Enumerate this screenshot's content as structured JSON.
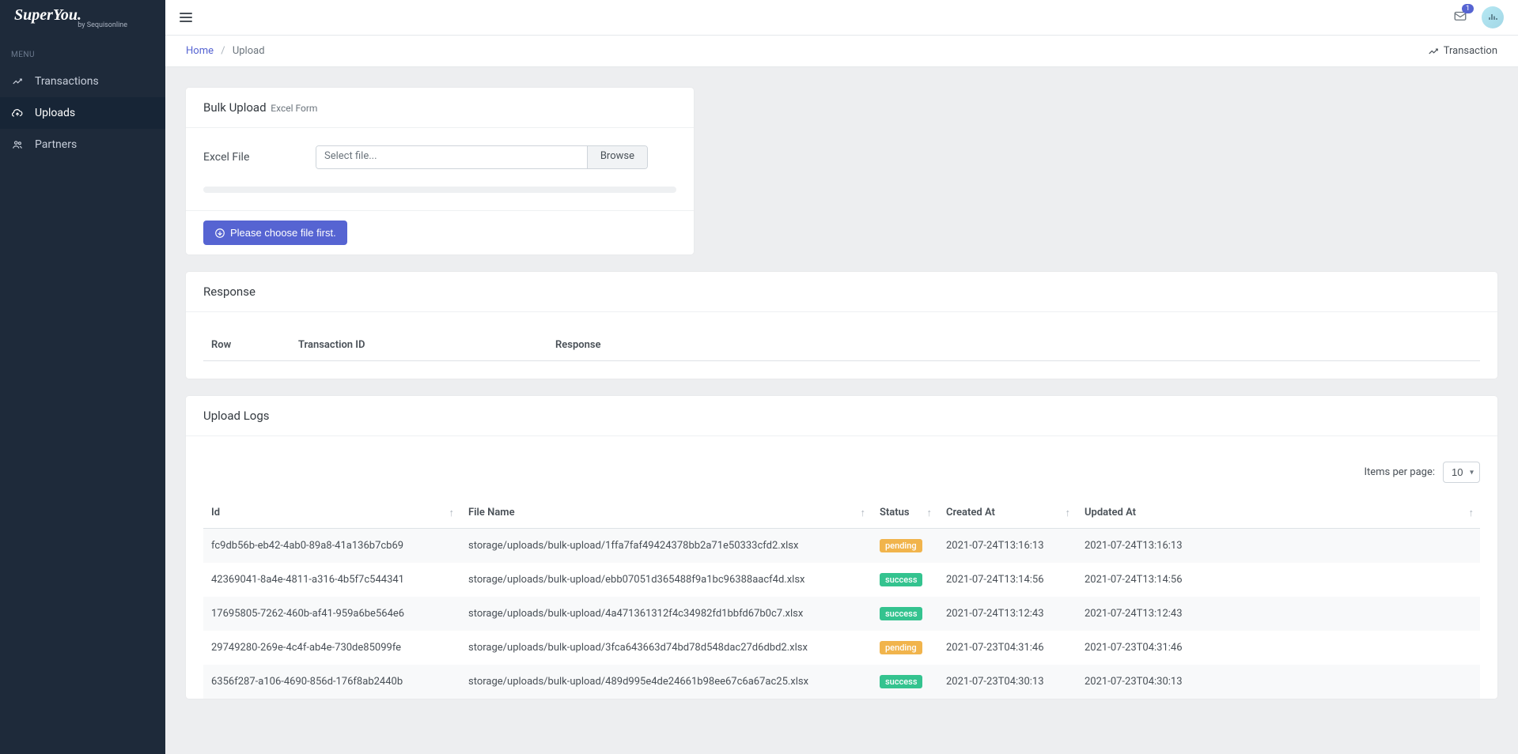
{
  "brand": {
    "main": "SuperYou.",
    "sub": "by Sequisonline"
  },
  "sidebar": {
    "menu_label": "MENU",
    "items": [
      {
        "label": "Transactions",
        "icon": "chart"
      },
      {
        "label": "Uploads",
        "icon": "cloud"
      },
      {
        "label": "Partners",
        "icon": "users"
      }
    ]
  },
  "topbar": {
    "notif_count": "1"
  },
  "breadcrumb": {
    "home": "Home",
    "current": "Upload",
    "page_label": "Transaction"
  },
  "upload_card": {
    "title": "Bulk Upload",
    "subtitle": "Excel Form",
    "field_label": "Excel File",
    "placeholder": "Select file...",
    "browse": "Browse",
    "submit": "Please choose file first."
  },
  "response_card": {
    "title": "Response",
    "columns": [
      "Row",
      "Transaction ID",
      "Response"
    ]
  },
  "logs_card": {
    "title": "Upload Logs",
    "pager_label": "Items per page:",
    "pager_value": "10",
    "columns": [
      "Id",
      "File Name",
      "Status",
      "Created At",
      "Updated At"
    ],
    "rows": [
      {
        "id": "fc9db56b-eb42-4ab0-89a8-41a136b7cb69",
        "file": "storage/uploads/bulk-upload/1ffa7faf49424378bb2a71e50333cfd2.xlsx",
        "status": "pending",
        "created": "2021-07-24T13:16:13",
        "updated": "2021-07-24T13:16:13"
      },
      {
        "id": "42369041-8a4e-4811-a316-4b5f7c544341",
        "file": "storage/uploads/bulk-upload/ebb07051d365488f9a1bc96388aacf4d.xlsx",
        "status": "success",
        "created": "2021-07-24T13:14:56",
        "updated": "2021-07-24T13:14:56"
      },
      {
        "id": "17695805-7262-460b-af41-959a6be564e6",
        "file": "storage/uploads/bulk-upload/4a471361312f4c34982fd1bbfd67b0c7.xlsx",
        "status": "success",
        "created": "2021-07-24T13:12:43",
        "updated": "2021-07-24T13:12:43"
      },
      {
        "id": "29749280-269e-4c4f-ab4e-730de85099fe",
        "file": "storage/uploads/bulk-upload/3fca643663d74bd78d548dac27d6dbd2.xlsx",
        "status": "pending",
        "created": "2021-07-23T04:31:46",
        "updated": "2021-07-23T04:31:46"
      },
      {
        "id": "6356f287-a106-4690-856d-176f8ab2440b",
        "file": "storage/uploads/bulk-upload/489d995e4de24661b98ee67c6a67ac25.xlsx",
        "status": "success",
        "created": "2021-07-23T04:30:13",
        "updated": "2021-07-23T04:30:13"
      }
    ]
  }
}
